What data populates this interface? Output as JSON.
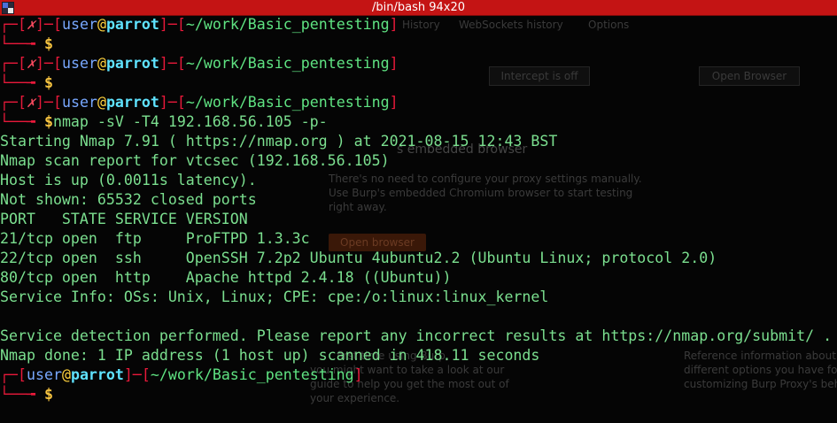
{
  "window": {
    "title": "/bin/bash 94x20"
  },
  "background_app": {
    "tab_history": "History",
    "tab_websockets": "WebSockets history",
    "tab_options": "Options",
    "btn_intercept": "Intercept is off",
    "btn_open_browser": "Open Browser",
    "heading_embedded": "s embedded browser",
    "para_embedded_1": "There's no need to configure your proxy settings manually.",
    "para_embedded_2": "Use Burp's embedded Chromium browser to start testing",
    "para_embedded_3": "right away.",
    "btn_open_browser_2": "Open browser",
    "para_guide_1": "first time using Burp,",
    "para_guide_2": "you might want to take a look at our",
    "para_guide_3": "guide to help you get the most out of",
    "para_guide_4": "your experience.",
    "para_ref_1": "Reference information about t",
    "para_ref_2": "different options you have for",
    "para_ref_3": "customizing Burp Proxy's beh"
  },
  "prompt": {
    "user": "user",
    "at": "@",
    "host": "parrot",
    "path": "~/work/Basic_pentesting",
    "x_mark": "✗",
    "dollar": "$"
  },
  "session": {
    "command": "nmap -sV -T4 192.168.56.105 -p-",
    "output": [
      "Starting Nmap 7.91 ( https://nmap.org ) at 2021-08-15 12:43 BST",
      "Nmap scan report for vtcsec (192.168.56.105)",
      "Host is up (0.0011s latency).",
      "Not shown: 65532 closed ports",
      "PORT   STATE SERVICE VERSION",
      "21/tcp open  ftp     ProFTPD 1.3.3c",
      "22/tcp open  ssh     OpenSSH 7.2p2 Ubuntu 4ubuntu2.2 (Ubuntu Linux; protocol 2.0)",
      "80/tcp open  http    Apache httpd 2.4.18 ((Ubuntu))",
      "Service Info: OSs: Unix, Linux; CPE: cpe:/o:linux:linux_kernel",
      "",
      "Service detection performed. Please report any incorrect results at https://nmap.org/submit/ .",
      "Nmap done: 1 IP address (1 host up) scanned in 418.11 seconds"
    ]
  },
  "colors": {
    "titlebar": "#c41414",
    "prompt_frame": "#e8193a",
    "user": "#78a8ff",
    "at": "#ffd23e",
    "host": "#5fe3ff",
    "path": "#5fe382",
    "text": "#7bdf8f"
  }
}
